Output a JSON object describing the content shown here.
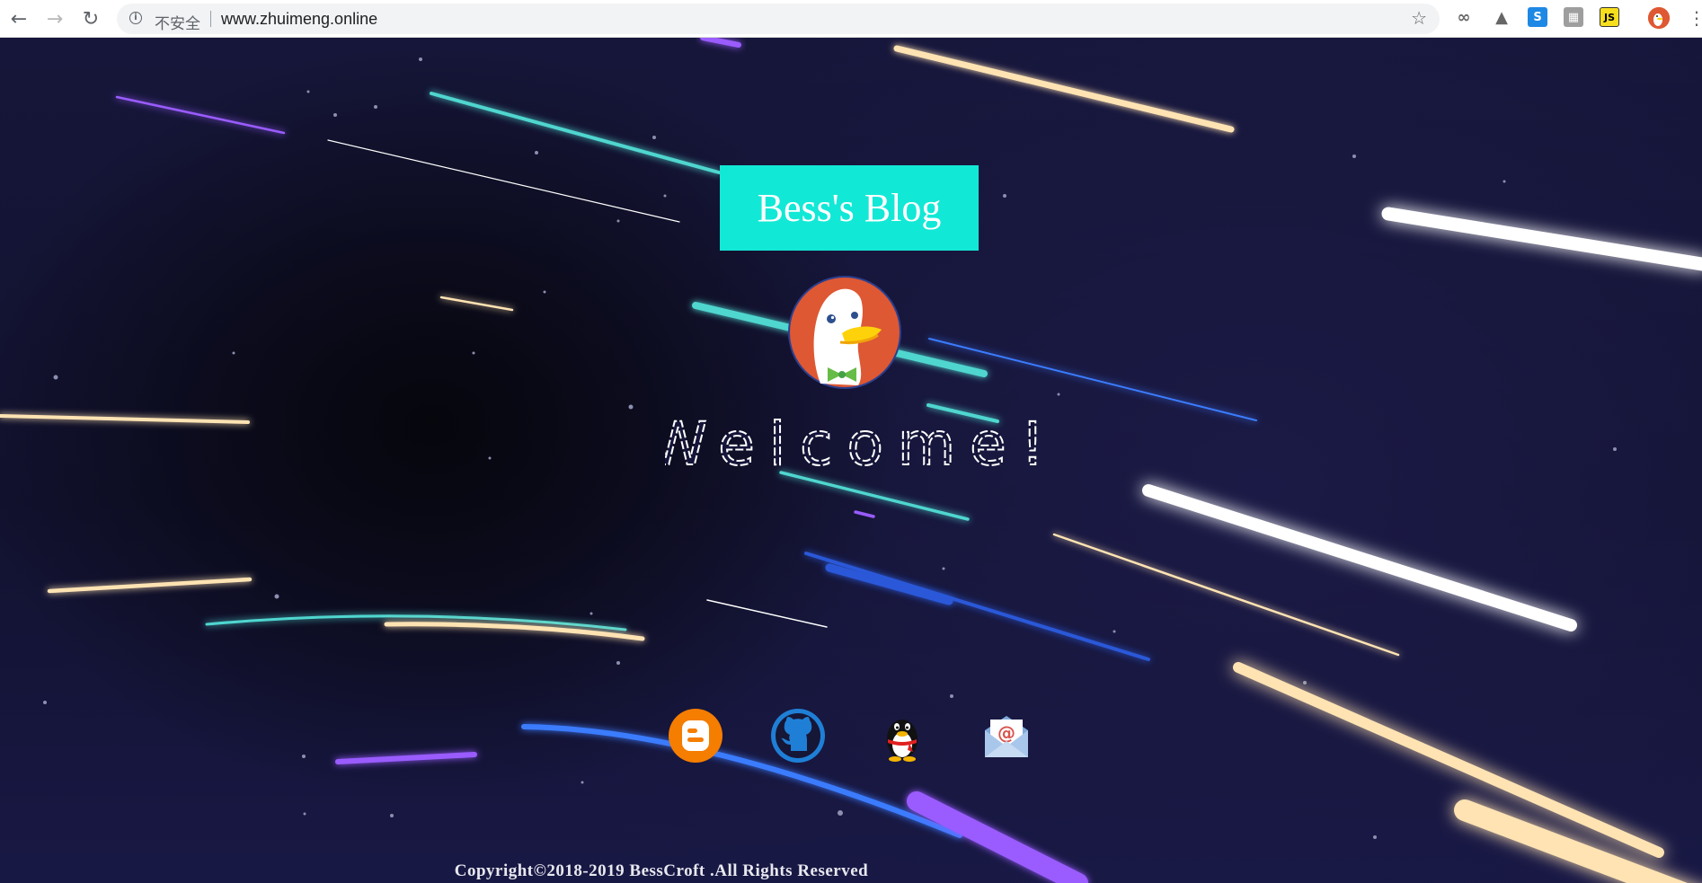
{
  "browser": {
    "security_label": "不安全",
    "url": "www.zhuimeng.online",
    "extensions": [
      "∞",
      "▲",
      "S",
      "▦",
      "JS",
      "🦆"
    ],
    "icons": {
      "back": "arrow-left-icon",
      "forward": "arrow-right-icon",
      "reload": "reload-icon",
      "info": "info-icon",
      "bookmark": "star-icon",
      "menu": "kebab-menu-icon"
    }
  },
  "page": {
    "title": "Bess's Blog",
    "greeting": "Welcome!",
    "copyright": "Copyright©2018-2019 BessCroft .All Rights Reserved",
    "social_links": [
      "blog-icon",
      "github-icon",
      "qq-penguin-icon",
      "email-icon"
    ],
    "colors": {
      "title_bg": "#12e8d6",
      "background": "#141436",
      "streak_cream": "#ffe3b3",
      "streak_teal": "#4fd6cf",
      "streak_purple": "#9a5cff",
      "streak_blue": "#3b7cff",
      "streak_white": "#ffffff"
    }
  }
}
